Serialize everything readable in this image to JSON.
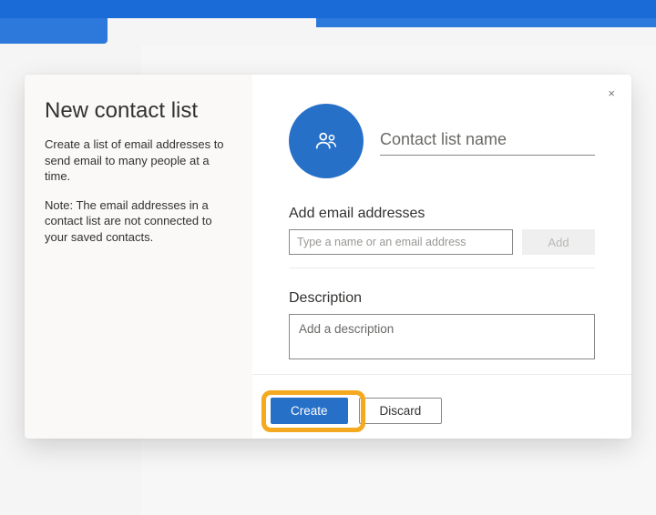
{
  "colors": {
    "accent": "#2770c8",
    "highlight": "#f4a91f"
  },
  "modal": {
    "close_label": "×",
    "left": {
      "title": "New contact list",
      "intro": "Create a list of email addresses to send email to many people at a time.",
      "note": "Note: The email addresses in a contact list are not connected to your saved contacts."
    },
    "right": {
      "avatar_icon": "people-icon",
      "name_placeholder": "Contact list name",
      "name_value": "",
      "emails": {
        "label": "Add email addresses",
        "input_placeholder": "Type a name or an email address",
        "input_value": "",
        "add_label": "Add"
      },
      "description": {
        "label": "Description",
        "placeholder": "Add a description",
        "value": ""
      },
      "footer": {
        "create_label": "Create",
        "discard_label": "Discard"
      }
    }
  }
}
